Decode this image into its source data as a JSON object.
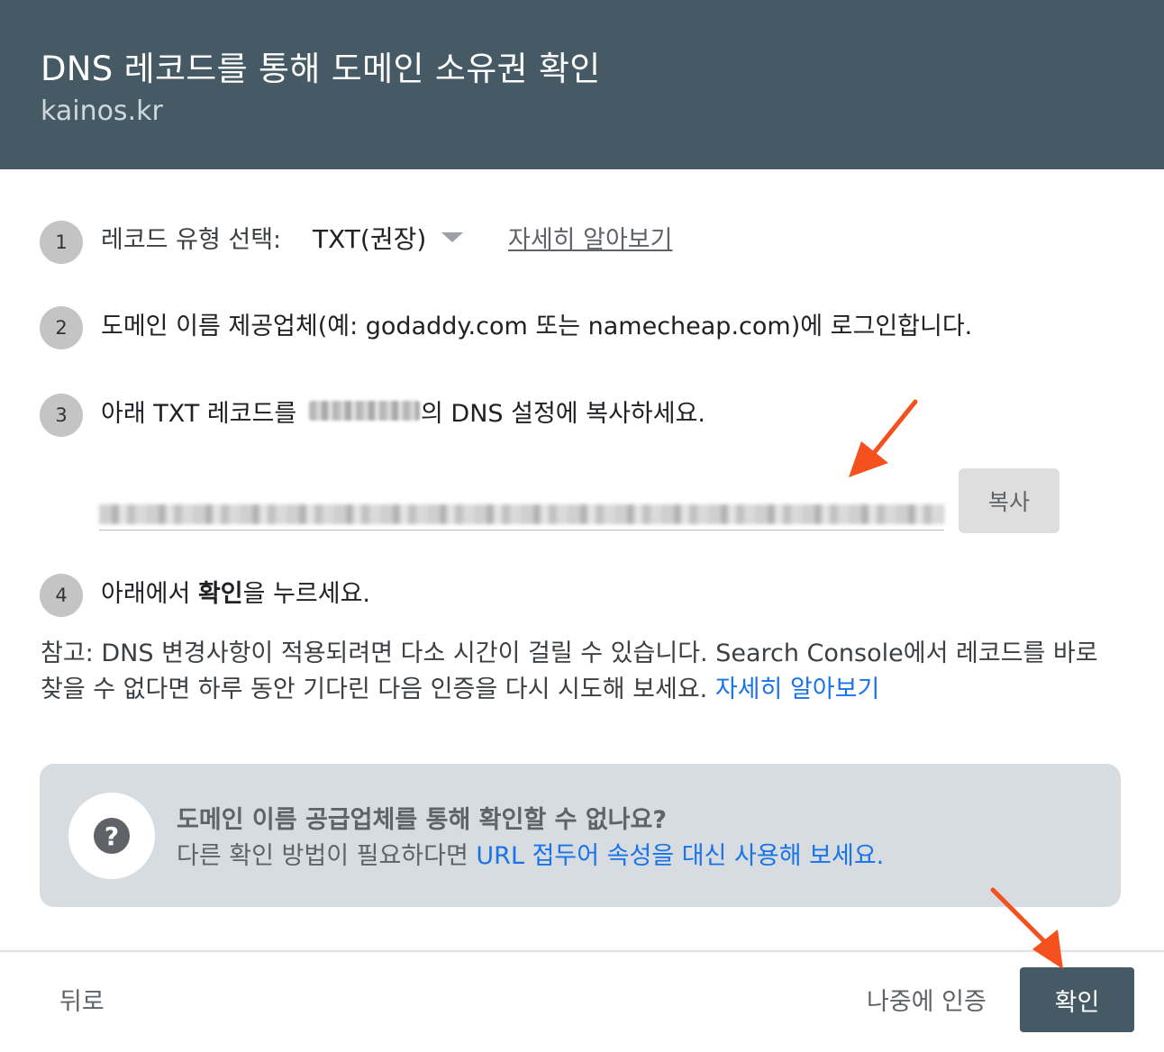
{
  "header": {
    "title": "DNS 레코드를 통해 도메인 소유권 확인",
    "domain": "kainos.kr"
  },
  "steps": [
    {
      "number": "1"
    },
    {
      "number": "2",
      "text": "도메인 이름 제공업체(예: godaddy.com 또는 namecheap.com)에 로그인합니다."
    },
    {
      "number": "3",
      "text_before": "아래 TXT 레코드를 ",
      "text_after": "의 DNS 설정에 복사하세요."
    },
    {
      "number": "4",
      "text_before": "아래에서 ",
      "text_bold": "확인",
      "text_after": "을 누르세요."
    }
  ],
  "record_type": {
    "label": "레코드 유형 선택:",
    "value": "TXT(권장)",
    "learn_more": "자세히 알아보기"
  },
  "copy_button": "복사",
  "note": {
    "line1": "참고: DNS 변경사항이 적용되려면 다소 시간이 걸릴 수 있습니다. Search Console에서 레코드를 바로",
    "line2": "찾을 수 없다면 하루 동안 기다린 다음 인증을 다시 시도해 보세요. ",
    "link": "자세히 알아보기"
  },
  "help": {
    "title": "도메인 이름 공급업체를 통해 확인할 수 없나요?",
    "body": "다른 확인 방법이 필요하다면 ",
    "link": "URL 접두어 속성을 대신 사용해 보세요."
  },
  "footer": {
    "back": "뒤로",
    "later": "나중에 인증",
    "confirm": "확인"
  },
  "colors": {
    "header_bg": "#455a64",
    "link": "#1a73e8",
    "annotation_arrow": "#f4511e"
  }
}
